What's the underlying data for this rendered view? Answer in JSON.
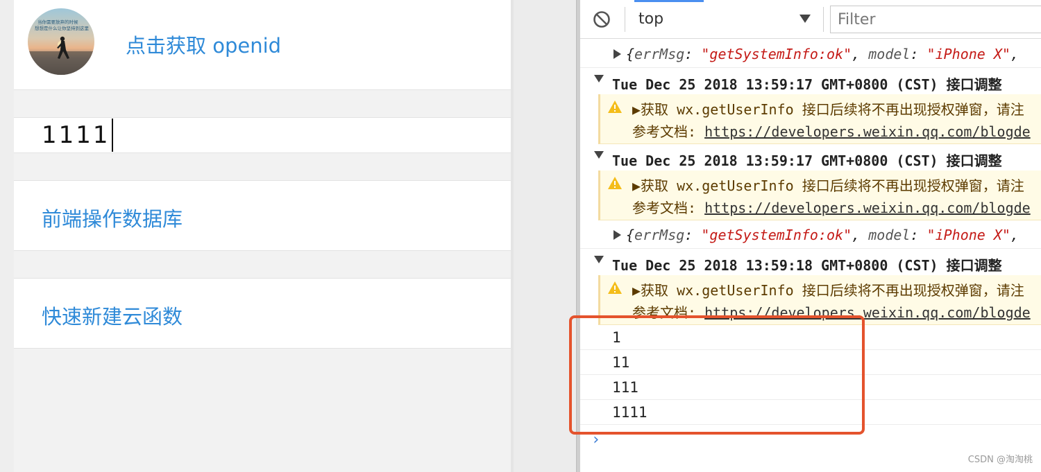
{
  "simulator": {
    "openid_button": "点击获取 openid",
    "input_value": "1111",
    "db_link": "前端操作数据库",
    "cloud_fn_link": "快速新建云函数",
    "avatar_icon": "avatar-image",
    "avatar_caption_line1": "当你需要放弃的时候",
    "avatar_caption_line2": "想想是什么让你坚持到这里"
  },
  "console": {
    "toolbar": {
      "context": "top",
      "filter_placeholder": "Filter",
      "clear_icon": "clear-console-icon",
      "accent_color": "#4a8ff0"
    },
    "entries": [
      {
        "kind": "object",
        "p1": "{",
        "k1": "errMsg",
        "s1": "\"getSystemInfo:ok\"",
        "p2": ", ",
        "k2": "model",
        "s2": "\"iPhone X\"",
        "p3": ","
      },
      {
        "kind": "group",
        "text": "Tue Dec 25 2018 13:59:17 GMT+0800 (CST) 接口调整"
      },
      {
        "kind": "warning",
        "line1": "▶获取 wx.getUserInfo 接口后续将不再出现授权弹窗，请注",
        "line2_prefix": "参考文档: ",
        "line2_url": "https://developers.weixin.qq.com/blogde"
      },
      {
        "kind": "group",
        "text": "Tue Dec 25 2018 13:59:17 GMT+0800 (CST) 接口调整"
      },
      {
        "kind": "warning",
        "line1": "▶获取 wx.getUserInfo 接口后续将不再出现授权弹窗，请注",
        "line2_prefix": "参考文档: ",
        "line2_url": "https://developers.weixin.qq.com/blogde"
      },
      {
        "kind": "object",
        "p1": "{",
        "k1": "errMsg",
        "s1": "\"getSystemInfo:ok\"",
        "p2": ", ",
        "k2": "model",
        "s2": "\"iPhone X\"",
        "p3": ","
      },
      {
        "kind": "group",
        "text": "Tue Dec 25 2018 13:59:18 GMT+0800 (CST) 接口调整"
      },
      {
        "kind": "warning",
        "line1": "▶获取 wx.getUserInfo 接口后续将不再出现授权弹窗，请注",
        "line2_prefix": "参考文档: ",
        "line2_url": "https://developers.weixin.qq.com/blogde"
      }
    ],
    "logs": [
      "1",
      "11",
      "111",
      "1111"
    ],
    "prompt": "›",
    "highlight_color": "#e4532d"
  },
  "watermark": "CSDN @淘淘桃"
}
